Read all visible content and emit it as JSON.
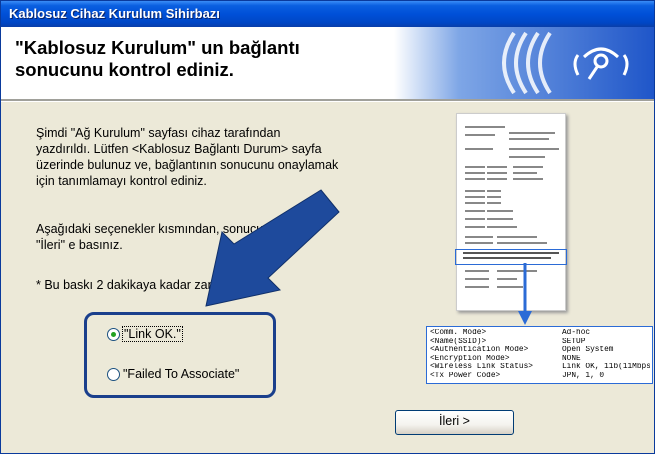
{
  "window": {
    "title": "Kablosuz Cihaz Kurulum Sihirbazı"
  },
  "header": {
    "heading": "\"Kablosuz Kurulum\" un bağlantı\nsonucunu kontrol ediniz."
  },
  "content": {
    "paragraph1": "Şimdi \"Ağ Kurulum\" sayfası cihaz tarafından\nyazdırıldı. Lütfen <Kablosuz Bağlantı Durum> sayfa\nüzerinde bulunuz ve, bağlantının sonucunu onaylamak\niçin tanımlamayı kontrol ediniz.",
    "paragraph2": "Aşağıdaki seçenekler kısmından, sonucu seçiniz,\n\"İleri\" e basınız.",
    "note": "* Bu baskı 2 dakikaya kadar zaman alabilir."
  },
  "options": [
    {
      "label": "\"Link OK.\"",
      "selected": true
    },
    {
      "label": "\"Failed To Associate\"",
      "selected": false
    }
  ],
  "buttons": {
    "next": "İleri >"
  },
  "callout": {
    "rows": [
      {
        "key": "<Comm. Mode>",
        "value": "Ad-hoc"
      },
      {
        "key": "<Name(SSID)>",
        "value": "SETUP"
      },
      {
        "key": "<Authentication Mode>",
        "value": "Open System"
      },
      {
        "key": "<Encryption Mode>",
        "value": "NONE"
      },
      {
        "key": "<Wireless Link Status>",
        "value": "Link OK, 11b(11Mbps)"
      },
      {
        "key": "<Tx Power Code>",
        "value": "JPN, 1, 0"
      }
    ]
  },
  "colors": {
    "title_bar": "#0050d8",
    "arrow": "#1e4a9c",
    "group_border": "#1a3f8c",
    "callout_border": "#2b6bd6"
  },
  "icons": {
    "banner": "wireless-antenna-icon",
    "pointer": "big-arrow-icon"
  }
}
